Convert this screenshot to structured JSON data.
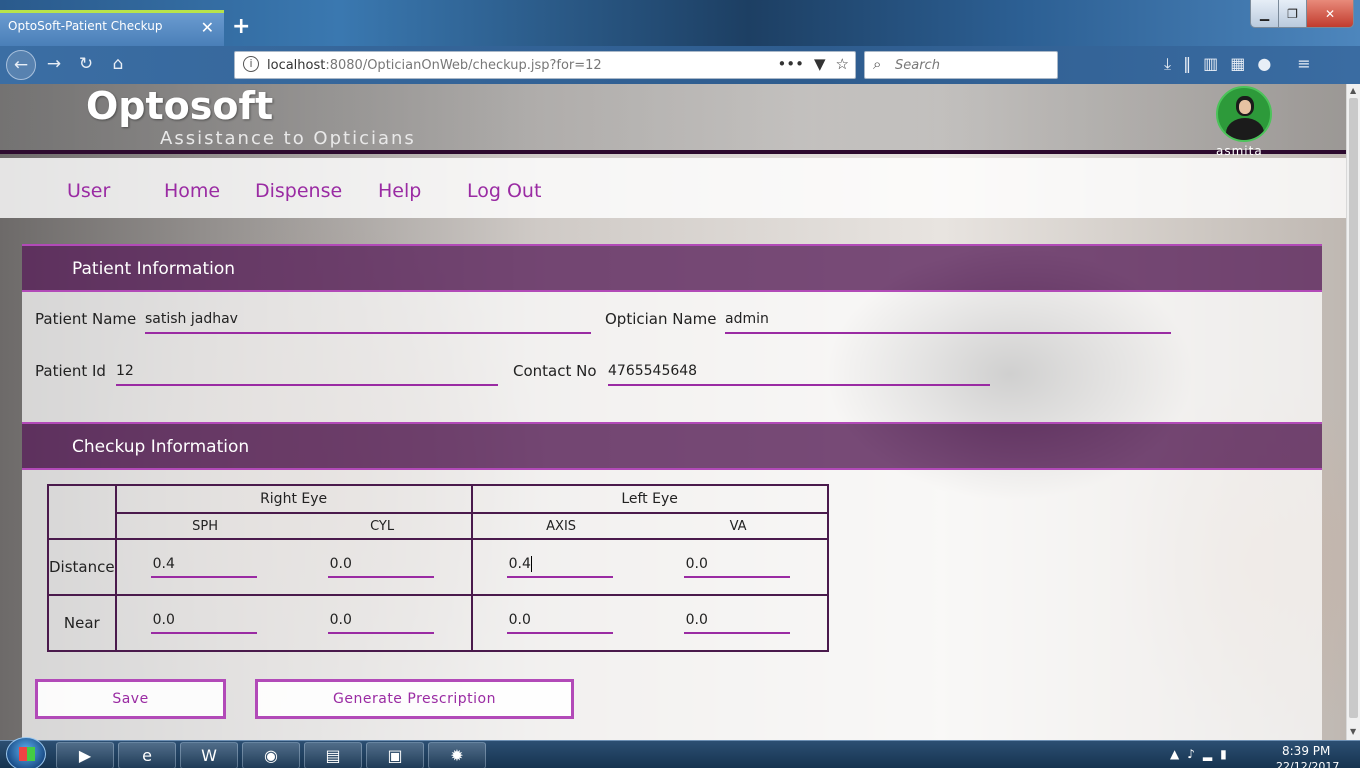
{
  "browser": {
    "tab_title": "OptoSoft-Patient Checkup",
    "tab_close": "✕",
    "new_tab": "+",
    "url_host": "localhost",
    "url_path": ":8080/OpticianOnWeb/checkup.jsp?for=12",
    "url_more": "•••",
    "search_placeholder": "Search"
  },
  "app": {
    "brand": "Optosoft",
    "tagline": "Assistance to Opticians",
    "username": "asmita"
  },
  "menu": {
    "items": [
      "User",
      "Home",
      "Dispense",
      "Help",
      "Log Out"
    ]
  },
  "patient_info": {
    "section_title": "Patient Information",
    "patient_name_label": "Patient Name",
    "patient_name_value": "satish jadhav",
    "optician_name_label": "Optician Name",
    "optician_name_value": "admin",
    "patient_id_label": "Patient Id",
    "patient_id_value": "12",
    "contact_label": "Contact No",
    "contact_value": "4765545648"
  },
  "checkup_info": {
    "section_title": "Checkup Information",
    "right_eye": "Right Eye",
    "left_eye": "Left Eye",
    "columns": [
      "SPH",
      "CYL",
      "AXIS",
      "VA"
    ],
    "rows": [
      {
        "label": "Distance",
        "values": [
          "0.4",
          "0.0",
          "0.4",
          "0.0"
        ]
      },
      {
        "label": "Near",
        "values": [
          "0.0",
          "0.0",
          "0.0",
          "0.0"
        ]
      }
    ]
  },
  "buttons": {
    "save": "Save",
    "generate": "Generate Prescription"
  },
  "taskbar": {
    "time": "8:39 PM",
    "date": "22/12/2017"
  }
}
